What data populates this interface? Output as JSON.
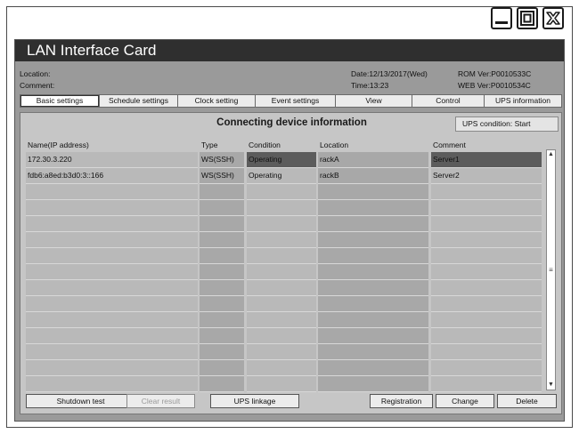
{
  "app": {
    "title": "LAN Interface Card",
    "info": {
      "location_label": "Location:",
      "comment_label": "Comment:",
      "date": "Date:12/13/2017(Wed)",
      "time": "Time:13:23",
      "rom_ver": "ROM Ver:P0010533C",
      "web_ver": "WEB Ver:P0010534C"
    },
    "tabs": [
      {
        "label": "Basic settings",
        "active": true
      },
      {
        "label": "Schedule settings",
        "active": false
      },
      {
        "label": "Clock setting",
        "active": false
      },
      {
        "label": "Event settings",
        "active": false
      },
      {
        "label": "View",
        "active": false
      },
      {
        "label": "Control",
        "active": false
      },
      {
        "label": "UPS information",
        "active": false
      }
    ],
    "panel": {
      "title": "Connecting device information",
      "ups_condition": "UPS condition: Start",
      "columns": [
        "Name(IP address)",
        "Type",
        "Condition",
        "Location",
        "Comment"
      ],
      "rows": [
        {
          "name": "172.30.3.220",
          "type": "WS(SSH)",
          "condition": "Operating",
          "location": "rackA",
          "comment": "Server1"
        },
        {
          "name": "fdb6:a8ed:b3d0:3::166",
          "type": "WS(SSH)",
          "condition": "Operating",
          "location": "rackB",
          "comment": "Server2"
        }
      ],
      "empty_rows": 13,
      "selected_row": 0
    },
    "buttons": {
      "shutdown_test": "Shutdown test",
      "clear_result": "Clear result",
      "ups_linkage": "UPS linkage",
      "registration": "Registration",
      "change": "Change",
      "delete": "Delete"
    }
  },
  "window_controls": [
    "minimize-icon",
    "maximize-icon",
    "close-icon"
  ],
  "colors": {
    "title_bar": "#2f2f2f",
    "panel_bg": "#c6c6c6",
    "outer_bg": "#9a9a9a",
    "selected_cell": "#5c5c5c"
  }
}
